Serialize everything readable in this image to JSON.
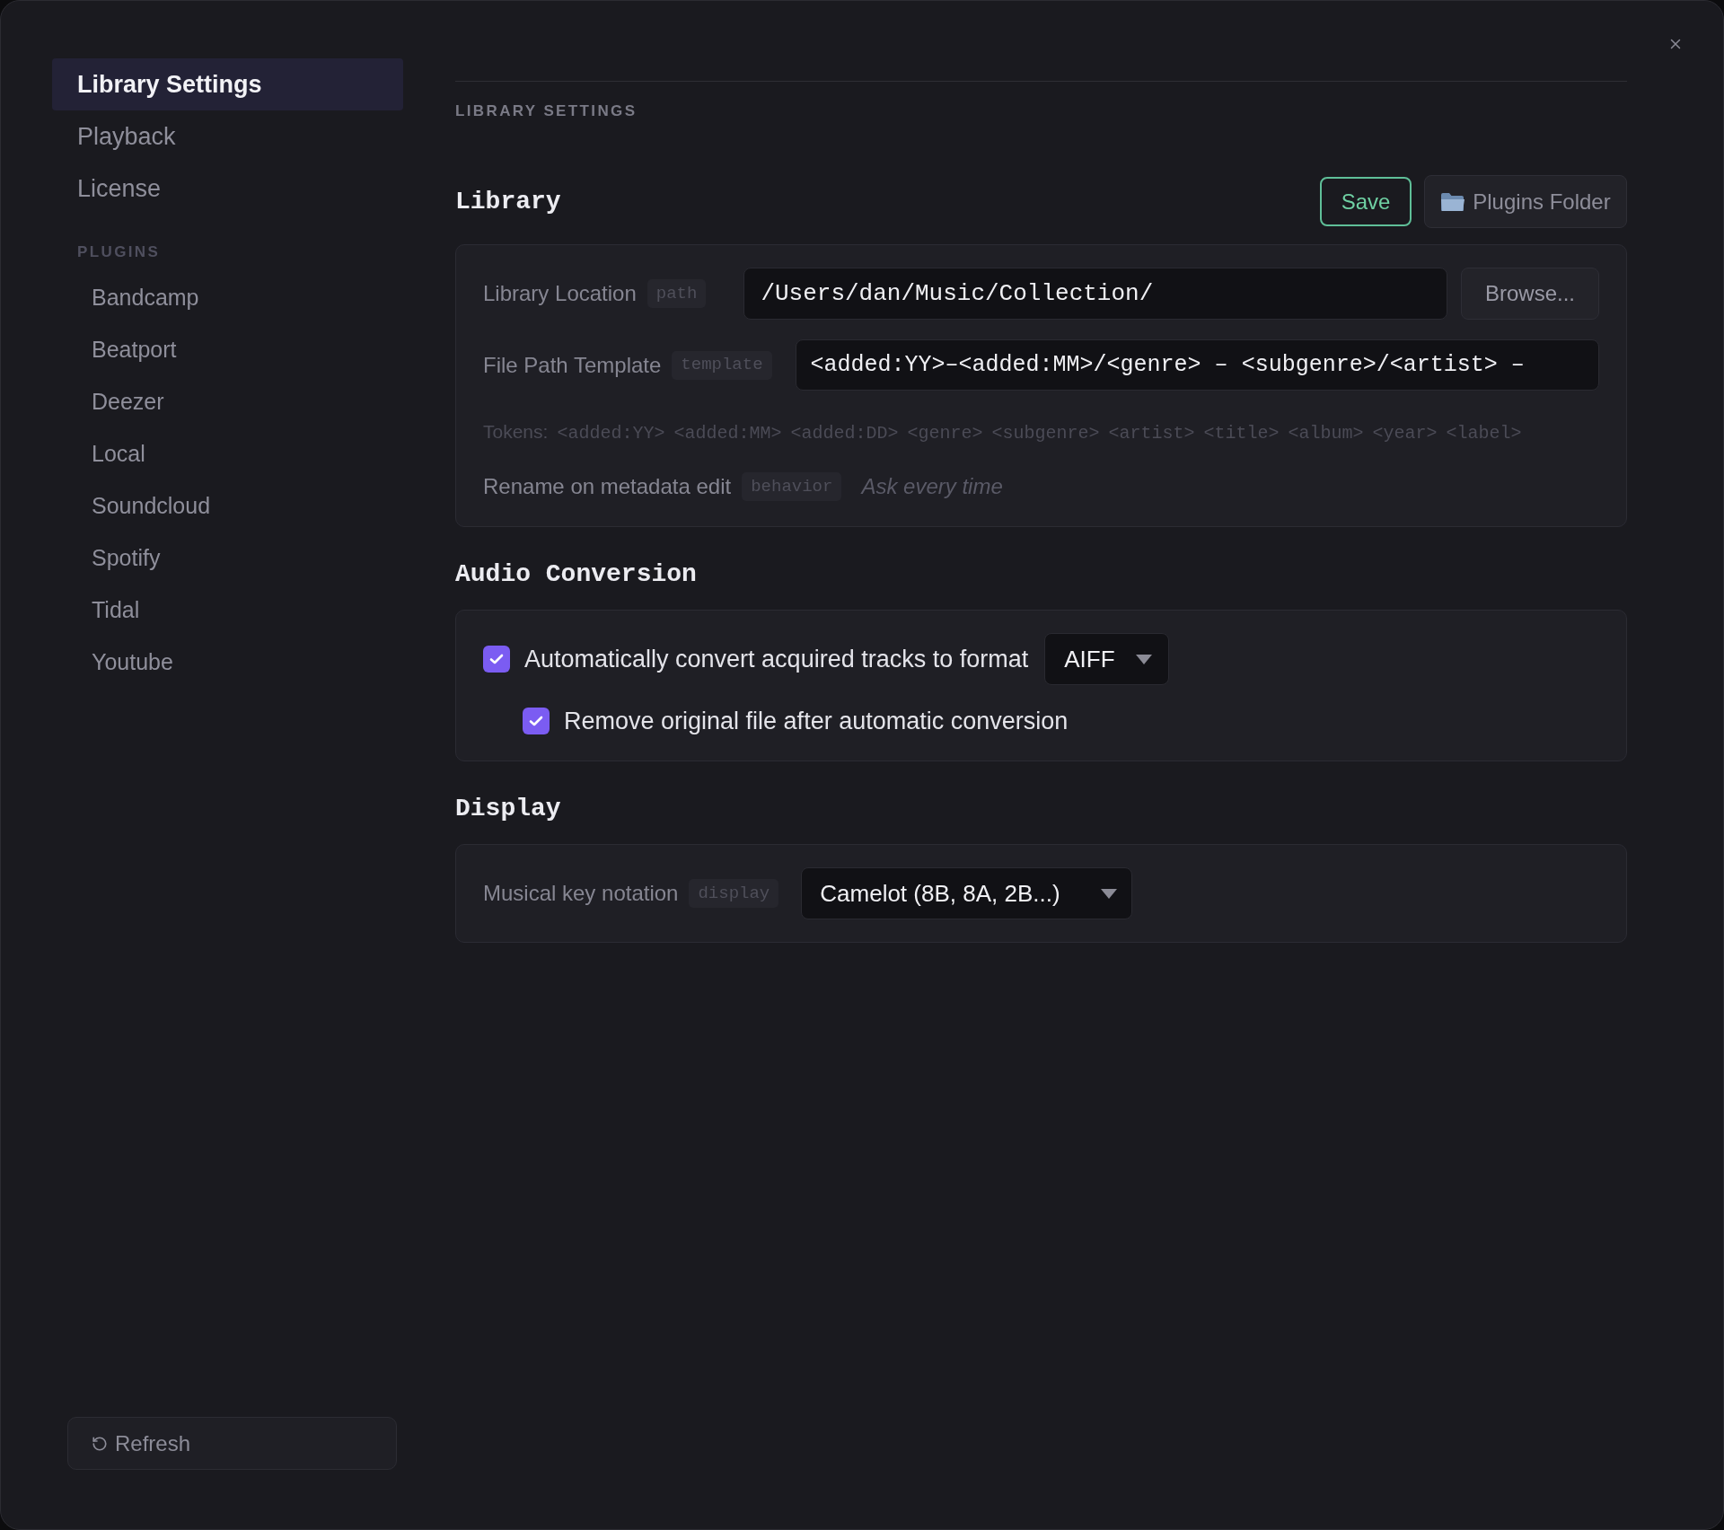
{
  "sidebar": {
    "items": [
      {
        "label": "Library Settings",
        "selected": true
      },
      {
        "label": "Playback",
        "selected": false
      },
      {
        "label": "License",
        "selected": false
      }
    ],
    "plugins_heading": "PLUGINS",
    "plugins": [
      {
        "label": "Bandcamp",
        "selected": false
      },
      {
        "label": "Beatport",
        "selected": false
      },
      {
        "label": "Deezer",
        "selected": false
      },
      {
        "label": "Local",
        "selected": false
      },
      {
        "label": "Soundcloud",
        "selected": false
      },
      {
        "label": "Spotify",
        "selected": false
      },
      {
        "label": "Tidal",
        "selected": false
      },
      {
        "label": "Youtube",
        "selected": false
      }
    ],
    "refresh_button": "Refresh"
  },
  "page_title": "LIBRARY SETTINGS",
  "library": {
    "title": "Library",
    "save_button": "Save",
    "plugins_folder_button": "Plugins Folder",
    "rows": [
      {
        "kind": "path",
        "label": "Library Location",
        "badge": "path",
        "value": "/Users/dan/Music/Collection/",
        "button": "Browse..."
      },
      {
        "kind": "template",
        "label": "File Path Template",
        "badge": "template",
        "value": "<added:YY>–<added:MM>/<genre> – <subgenre>/<artist> –"
      },
      {
        "kind": "tokens",
        "label": "Tokens:",
        "tokens": [
          "<added:YY>",
          "<added:MM>",
          "<added:DD>",
          "<genre>",
          "<subgenre>",
          "<artist>",
          "<title>",
          "<album>",
          "<year>",
          "<label>"
        ]
      },
      {
        "kind": "setting",
        "label": "Rename on metadata edit",
        "badge": "behavior",
        "value": "Ask every time"
      }
    ]
  },
  "audio_conversion": {
    "title": "Audio Conversion",
    "options": [
      {
        "label": "Automatically convert acquired tracks to format",
        "checked": true,
        "format": "AIFF",
        "children": [
          {
            "label": "Remove original file after automatic conversion",
            "checked": true
          }
        ]
      }
    ]
  },
  "display": {
    "title": "Display",
    "rows": [
      {
        "label": "Musical key notation",
        "badge": "display",
        "value": "Camelot (8B, 8A, 2B...)"
      }
    ]
  }
}
